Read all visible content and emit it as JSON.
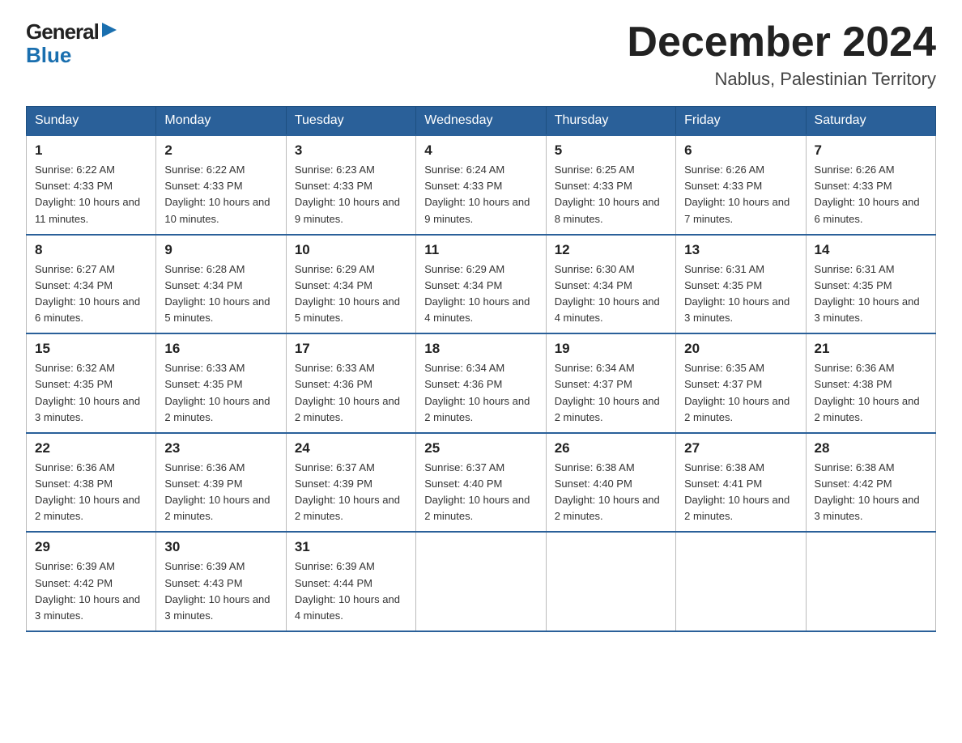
{
  "header": {
    "logo_line1": "General",
    "logo_line2": "Blue",
    "month_title": "December 2024",
    "location": "Nablus, Palestinian Territory"
  },
  "days_of_week": [
    "Sunday",
    "Monday",
    "Tuesday",
    "Wednesday",
    "Thursday",
    "Friday",
    "Saturday"
  ],
  "weeks": [
    [
      {
        "day": "1",
        "sunrise": "6:22 AM",
        "sunset": "4:33 PM",
        "daylight": "10 hours and 11 minutes."
      },
      {
        "day": "2",
        "sunrise": "6:22 AM",
        "sunset": "4:33 PM",
        "daylight": "10 hours and 10 minutes."
      },
      {
        "day": "3",
        "sunrise": "6:23 AM",
        "sunset": "4:33 PM",
        "daylight": "10 hours and 9 minutes."
      },
      {
        "day": "4",
        "sunrise": "6:24 AM",
        "sunset": "4:33 PM",
        "daylight": "10 hours and 9 minutes."
      },
      {
        "day": "5",
        "sunrise": "6:25 AM",
        "sunset": "4:33 PM",
        "daylight": "10 hours and 8 minutes."
      },
      {
        "day": "6",
        "sunrise": "6:26 AM",
        "sunset": "4:33 PM",
        "daylight": "10 hours and 7 minutes."
      },
      {
        "day": "7",
        "sunrise": "6:26 AM",
        "sunset": "4:33 PM",
        "daylight": "10 hours and 6 minutes."
      }
    ],
    [
      {
        "day": "8",
        "sunrise": "6:27 AM",
        "sunset": "4:34 PM",
        "daylight": "10 hours and 6 minutes."
      },
      {
        "day": "9",
        "sunrise": "6:28 AM",
        "sunset": "4:34 PM",
        "daylight": "10 hours and 5 minutes."
      },
      {
        "day": "10",
        "sunrise": "6:29 AM",
        "sunset": "4:34 PM",
        "daylight": "10 hours and 5 minutes."
      },
      {
        "day": "11",
        "sunrise": "6:29 AM",
        "sunset": "4:34 PM",
        "daylight": "10 hours and 4 minutes."
      },
      {
        "day": "12",
        "sunrise": "6:30 AM",
        "sunset": "4:34 PM",
        "daylight": "10 hours and 4 minutes."
      },
      {
        "day": "13",
        "sunrise": "6:31 AM",
        "sunset": "4:35 PM",
        "daylight": "10 hours and 3 minutes."
      },
      {
        "day": "14",
        "sunrise": "6:31 AM",
        "sunset": "4:35 PM",
        "daylight": "10 hours and 3 minutes."
      }
    ],
    [
      {
        "day": "15",
        "sunrise": "6:32 AM",
        "sunset": "4:35 PM",
        "daylight": "10 hours and 3 minutes."
      },
      {
        "day": "16",
        "sunrise": "6:33 AM",
        "sunset": "4:35 PM",
        "daylight": "10 hours and 2 minutes."
      },
      {
        "day": "17",
        "sunrise": "6:33 AM",
        "sunset": "4:36 PM",
        "daylight": "10 hours and 2 minutes."
      },
      {
        "day": "18",
        "sunrise": "6:34 AM",
        "sunset": "4:36 PM",
        "daylight": "10 hours and 2 minutes."
      },
      {
        "day": "19",
        "sunrise": "6:34 AM",
        "sunset": "4:37 PM",
        "daylight": "10 hours and 2 minutes."
      },
      {
        "day": "20",
        "sunrise": "6:35 AM",
        "sunset": "4:37 PM",
        "daylight": "10 hours and 2 minutes."
      },
      {
        "day": "21",
        "sunrise": "6:36 AM",
        "sunset": "4:38 PM",
        "daylight": "10 hours and 2 minutes."
      }
    ],
    [
      {
        "day": "22",
        "sunrise": "6:36 AM",
        "sunset": "4:38 PM",
        "daylight": "10 hours and 2 minutes."
      },
      {
        "day": "23",
        "sunrise": "6:36 AM",
        "sunset": "4:39 PM",
        "daylight": "10 hours and 2 minutes."
      },
      {
        "day": "24",
        "sunrise": "6:37 AM",
        "sunset": "4:39 PM",
        "daylight": "10 hours and 2 minutes."
      },
      {
        "day": "25",
        "sunrise": "6:37 AM",
        "sunset": "4:40 PM",
        "daylight": "10 hours and 2 minutes."
      },
      {
        "day": "26",
        "sunrise": "6:38 AM",
        "sunset": "4:40 PM",
        "daylight": "10 hours and 2 minutes."
      },
      {
        "day": "27",
        "sunrise": "6:38 AM",
        "sunset": "4:41 PM",
        "daylight": "10 hours and 2 minutes."
      },
      {
        "day": "28",
        "sunrise": "6:38 AM",
        "sunset": "4:42 PM",
        "daylight": "10 hours and 3 minutes."
      }
    ],
    [
      {
        "day": "29",
        "sunrise": "6:39 AM",
        "sunset": "4:42 PM",
        "daylight": "10 hours and 3 minutes."
      },
      {
        "day": "30",
        "sunrise": "6:39 AM",
        "sunset": "4:43 PM",
        "daylight": "10 hours and 3 minutes."
      },
      {
        "day": "31",
        "sunrise": "6:39 AM",
        "sunset": "4:44 PM",
        "daylight": "10 hours and 4 minutes."
      },
      null,
      null,
      null,
      null
    ]
  ],
  "labels": {
    "sunrise_prefix": "Sunrise: ",
    "sunset_prefix": "Sunset: ",
    "daylight_prefix": "Daylight: "
  }
}
